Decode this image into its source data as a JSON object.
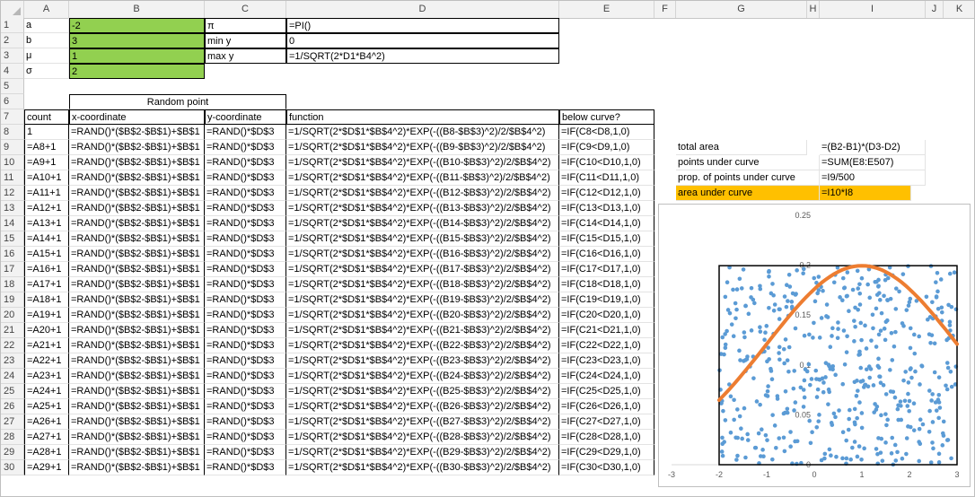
{
  "columns": [
    "A",
    "B",
    "C",
    "D",
    "E",
    "F",
    "G",
    "H",
    "I",
    "J",
    "K"
  ],
  "params": {
    "a_label": "a",
    "a_value": "-2",
    "b_label": "b",
    "b_value": "3",
    "mu_label": "μ",
    "mu_value": "1",
    "sigma_label": "σ",
    "sigma_value": "2",
    "pi_label": "π",
    "pi_formula": "=PI()",
    "miny_label": "min y",
    "miny_value": "0",
    "maxy_label": "max y",
    "maxy_formula": "=1/SQRT(2*D1*B4^2)"
  },
  "headers": {
    "random_point": "Random point",
    "count": "count",
    "x": "x-coordinate",
    "y": "y-coordinate",
    "func": "function",
    "below": "below curve?"
  },
  "summary": {
    "total_area_label": "total area",
    "total_area_formula": "=(B2-B1)*(D3-D2)",
    "points_label": "points under curve",
    "points_formula": "=SUM(E8:E507)",
    "prop_label": "prop. of points under curve",
    "prop_formula": "=I9/500",
    "area_label": "area under curve",
    "area_formula": "=I10*I8"
  },
  "rows": [
    {
      "n": "8",
      "count": "1",
      "x": "=RAND()*($B$2-$B$1)+$B$1",
      "y": "=RAND()*$D$3",
      "f": "=1/SQRT(2*$D$1*$B$4^2)*EXP(-((B8-$B$3)^2)/2/$B$4^2)",
      "e": "=IF(C8<D8,1,0)"
    },
    {
      "n": "9",
      "count": "=A8+1",
      "x": "=RAND()*($B$2-$B$1)+$B$1",
      "y": "=RAND()*$D$3",
      "f": "=1/SQRT(2*$D$1*$B$4^2)*EXP(-((B9-$B$3)^2)/2/$B$4^2)",
      "e": "=IF(C9<D9,1,0)"
    },
    {
      "n": "10",
      "count": "=A9+1",
      "x": "=RAND()*($B$2-$B$1)+$B$1",
      "y": "=RAND()*$D$3",
      "f": "=1/SQRT(2*$D$1*$B$4^2)*EXP(-((B10-$B$3)^2)/2/$B$4^2)",
      "e": "=IF(C10<D10,1,0)"
    },
    {
      "n": "11",
      "count": "=A10+1",
      "x": "=RAND()*($B$2-$B$1)+$B$1",
      "y": "=RAND()*$D$3",
      "f": "=1/SQRT(2*$D$1*$B$4^2)*EXP(-((B11-$B$3)^2)/2/$B$4^2)",
      "e": "=IF(C11<D11,1,0)"
    },
    {
      "n": "12",
      "count": "=A11+1",
      "x": "=RAND()*($B$2-$B$1)+$B$1",
      "y": "=RAND()*$D$3",
      "f": "=1/SQRT(2*$D$1*$B$4^2)*EXP(-((B12-$B$3)^2)/2/$B$4^2)",
      "e": "=IF(C12<D12,1,0)"
    },
    {
      "n": "13",
      "count": "=A12+1",
      "x": "=RAND()*($B$2-$B$1)+$B$1",
      "y": "=RAND()*$D$3",
      "f": "=1/SQRT(2*$D$1*$B$4^2)*EXP(-((B13-$B$3)^2)/2/$B$4^2)",
      "e": "=IF(C13<D13,1,0)"
    },
    {
      "n": "14",
      "count": "=A13+1",
      "x": "=RAND()*($B$2-$B$1)+$B$1",
      "y": "=RAND()*$D$3",
      "f": "=1/SQRT(2*$D$1*$B$4^2)*EXP(-((B14-$B$3)^2)/2/$B$4^2)",
      "e": "=IF(C14<D14,1,0)"
    },
    {
      "n": "15",
      "count": "=A14+1",
      "x": "=RAND()*($B$2-$B$1)+$B$1",
      "y": "=RAND()*$D$3",
      "f": "=1/SQRT(2*$D$1*$B$4^2)*EXP(-((B15-$B$3)^2)/2/$B$4^2)",
      "e": "=IF(C15<D15,1,0)"
    },
    {
      "n": "16",
      "count": "=A15+1",
      "x": "=RAND()*($B$2-$B$1)+$B$1",
      "y": "=RAND()*$D$3",
      "f": "=1/SQRT(2*$D$1*$B$4^2)*EXP(-((B16-$B$3)^2)/2/$B$4^2)",
      "e": "=IF(C16<D16,1,0)"
    },
    {
      "n": "17",
      "count": "=A16+1",
      "x": "=RAND()*($B$2-$B$1)+$B$1",
      "y": "=RAND()*$D$3",
      "f": "=1/SQRT(2*$D$1*$B$4^2)*EXP(-((B17-$B$3)^2)/2/$B$4^2)",
      "e": "=IF(C17<D17,1,0)"
    },
    {
      "n": "18",
      "count": "=A17+1",
      "x": "=RAND()*($B$2-$B$1)+$B$1",
      "y": "=RAND()*$D$3",
      "f": "=1/SQRT(2*$D$1*$B$4^2)*EXP(-((B18-$B$3)^2)/2/$B$4^2)",
      "e": "=IF(C18<D18,1,0)"
    },
    {
      "n": "19",
      "count": "=A18+1",
      "x": "=RAND()*($B$2-$B$1)+$B$1",
      "y": "=RAND()*$D$3",
      "f": "=1/SQRT(2*$D$1*$B$4^2)*EXP(-((B19-$B$3)^2)/2/$B$4^2)",
      "e": "=IF(C19<D19,1,0)"
    },
    {
      "n": "20",
      "count": "=A19+1",
      "x": "=RAND()*($B$2-$B$1)+$B$1",
      "y": "=RAND()*$D$3",
      "f": "=1/SQRT(2*$D$1*$B$4^2)*EXP(-((B20-$B$3)^2)/2/$B$4^2)",
      "e": "=IF(C20<D20,1,0)"
    },
    {
      "n": "21",
      "count": "=A20+1",
      "x": "=RAND()*($B$2-$B$1)+$B$1",
      "y": "=RAND()*$D$3",
      "f": "=1/SQRT(2*$D$1*$B$4^2)*EXP(-((B21-$B$3)^2)/2/$B$4^2)",
      "e": "=IF(C21<D21,1,0)"
    },
    {
      "n": "22",
      "count": "=A21+1",
      "x": "=RAND()*($B$2-$B$1)+$B$1",
      "y": "=RAND()*$D$3",
      "f": "=1/SQRT(2*$D$1*$B$4^2)*EXP(-((B22-$B$3)^2)/2/$B$4^2)",
      "e": "=IF(C22<D22,1,0)"
    },
    {
      "n": "23",
      "count": "=A22+1",
      "x": "=RAND()*($B$2-$B$1)+$B$1",
      "y": "=RAND()*$D$3",
      "f": "=1/SQRT(2*$D$1*$B$4^2)*EXP(-((B23-$B$3)^2)/2/$B$4^2)",
      "e": "=IF(C23<D23,1,0)"
    },
    {
      "n": "24",
      "count": "=A23+1",
      "x": "=RAND()*($B$2-$B$1)+$B$1",
      "y": "=RAND()*$D$3",
      "f": "=1/SQRT(2*$D$1*$B$4^2)*EXP(-((B24-$B$3)^2)/2/$B$4^2)",
      "e": "=IF(C24<D24,1,0)"
    },
    {
      "n": "25",
      "count": "=A24+1",
      "x": "=RAND()*($B$2-$B$1)+$B$1",
      "y": "=RAND()*$D$3",
      "f": "=1/SQRT(2*$D$1*$B$4^2)*EXP(-((B25-$B$3)^2)/2/$B$4^2)",
      "e": "=IF(C25<D25,1,0)"
    },
    {
      "n": "26",
      "count": "=A25+1",
      "x": "=RAND()*($B$2-$B$1)+$B$1",
      "y": "=RAND()*$D$3",
      "f": "=1/SQRT(2*$D$1*$B$4^2)*EXP(-((B26-$B$3)^2)/2/$B$4^2)",
      "e": "=IF(C26<D26,1,0)"
    },
    {
      "n": "27",
      "count": "=A26+1",
      "x": "=RAND()*($B$2-$B$1)+$B$1",
      "y": "=RAND()*$D$3",
      "f": "=1/SQRT(2*$D$1*$B$4^2)*EXP(-((B27-$B$3)^2)/2/$B$4^2)",
      "e": "=IF(C27<D27,1,0)"
    },
    {
      "n": "28",
      "count": "=A27+1",
      "x": "=RAND()*($B$2-$B$1)+$B$1",
      "y": "=RAND()*$D$3",
      "f": "=1/SQRT(2*$D$1*$B$4^2)*EXP(-((B28-$B$3)^2)/2/$B$4^2)",
      "e": "=IF(C28<D28,1,0)"
    },
    {
      "n": "29",
      "count": "=A28+1",
      "x": "=RAND()*($B$2-$B$1)+$B$1",
      "y": "=RAND()*$D$3",
      "f": "=1/SQRT(2*$D$1*$B$4^2)*EXP(-((B29-$B$3)^2)/2/$B$4^2)",
      "e": "=IF(C29<D29,1,0)"
    },
    {
      "n": "30",
      "count": "=A29+1",
      "x": "=RAND()*($B$2-$B$1)+$B$1",
      "y": "=RAND()*$D$3",
      "f": "=1/SQRT(2*$D$1*$B$4^2)*EXP(-((B30-$B$3)^2)/2/$B$4^2)",
      "e": "=IF(C30<D30,1,0)"
    }
  ],
  "row_numbers": [
    "1",
    "2",
    "3",
    "4",
    "5",
    "6",
    "7"
  ],
  "chart_data": {
    "type": "scatter",
    "x_ticks": [
      "-3",
      "-2",
      "-1",
      "0",
      "1",
      "2",
      "3"
    ],
    "y_ticks": [
      "0",
      "0.05",
      "0.1",
      "0.15",
      "0.2",
      "0.25"
    ],
    "xlim": [
      -3,
      3
    ],
    "ylim": [
      0,
      0.25
    ],
    "rect": {
      "x": [
        -2,
        3
      ],
      "y": [
        0,
        0.1995
      ]
    },
    "curve": {
      "mu": 1,
      "sigma": 2,
      "x_range": [
        -2,
        3
      ]
    },
    "points_count": 500,
    "colors": {
      "points": "#5b9bd5",
      "curve": "#ed7d31",
      "rect": "#000000"
    }
  },
  "colors": {
    "green": "#92d050",
    "orange": "#ffc000",
    "header_bg": "#f2f2f2"
  }
}
